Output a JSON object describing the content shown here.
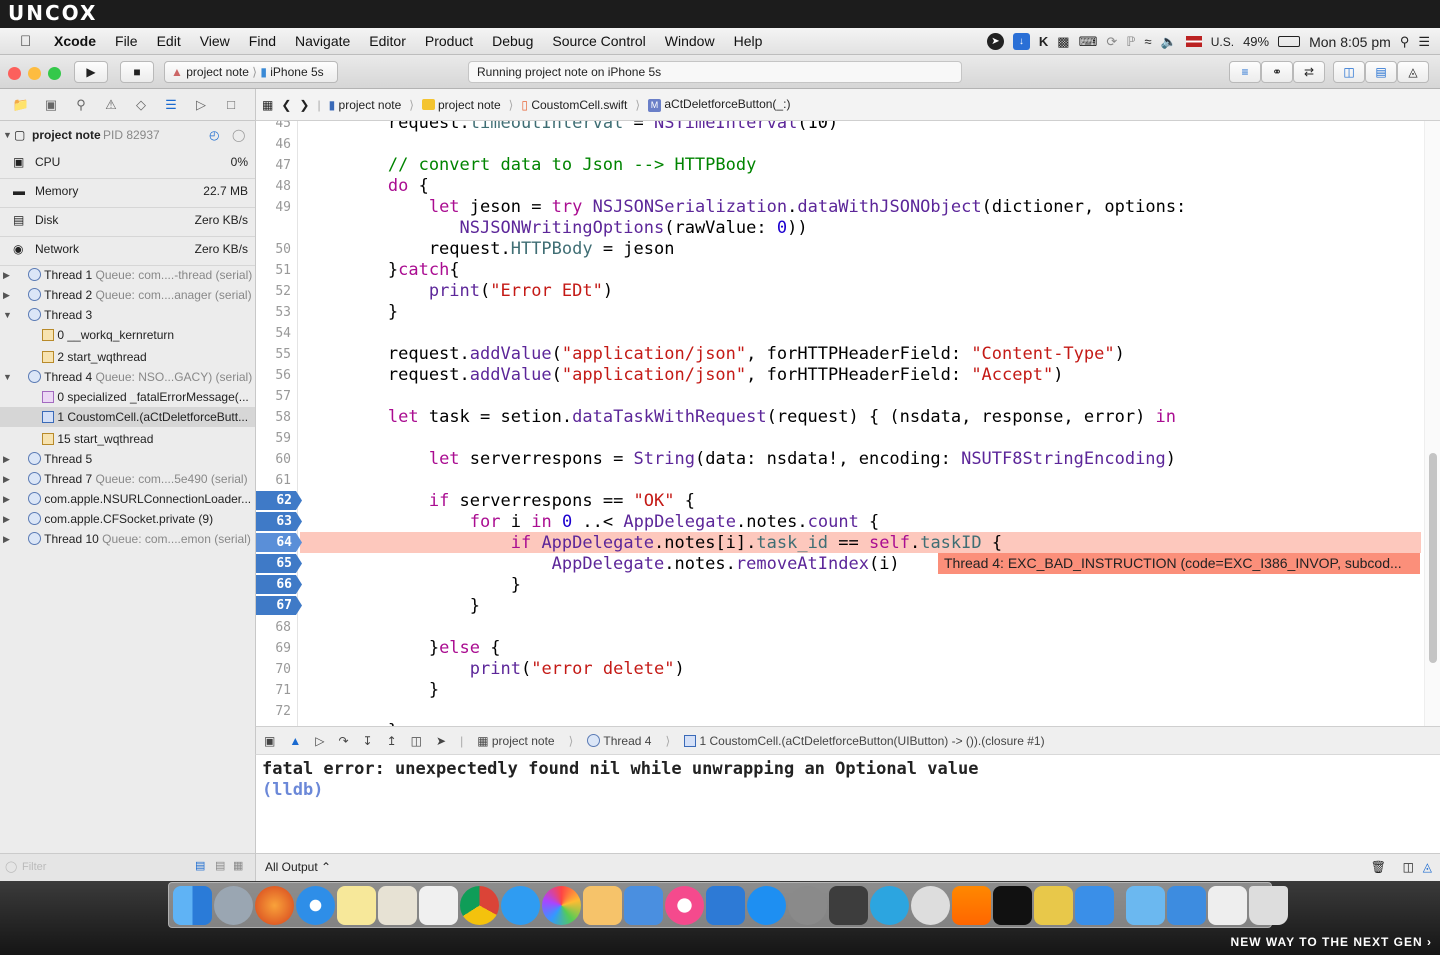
{
  "brand": {
    "logo": "UNCOX",
    "tagline": "NEW WAY TO THE NEXT GEN ›"
  },
  "menubar": {
    "app": "Xcode",
    "items": [
      "File",
      "Edit",
      "View",
      "Find",
      "Navigate",
      "Editor",
      "Product",
      "Debug",
      "Source Control",
      "Window",
      "Help"
    ],
    "input_source": "U.S.",
    "battery": "49%",
    "clock": "Mon 8:05 pm"
  },
  "toolbar": {
    "scheme_target": "project note",
    "scheme_device": "iPhone 5s",
    "activity": "Running project note on iPhone 5s"
  },
  "jumpbar": {
    "items": [
      "project note",
      "project note",
      "CoustomCell.swift",
      "aCtDeletforceButton(_:)"
    ]
  },
  "debug_navigator": {
    "process": "project note",
    "pid": "PID 82937",
    "gauges": [
      {
        "name": "CPU",
        "value": "0%"
      },
      {
        "name": "Memory",
        "value": "22.7 MB"
      },
      {
        "name": "Disk",
        "value": "Zero KB/s"
      },
      {
        "name": "Network",
        "value": "Zero KB/s"
      }
    ],
    "threads": [
      {
        "name": "Thread 1",
        "queue": "Queue: com....-thread (serial)"
      },
      {
        "name": "Thread 2",
        "queue": "Queue: com....anager (serial)"
      },
      {
        "name": "Thread 3",
        "queue": ""
      },
      {
        "frame": "0 __workq_kernreturn"
      },
      {
        "frame": "2 start_wqthread"
      },
      {
        "name": "Thread 4",
        "queue": "Queue: NSO...GACY) (serial)"
      },
      {
        "frame": "0 specialized _fatalErrorMessage(..."
      },
      {
        "frame": "1 CoustomCell.(aCtDeletforceButt..."
      },
      {
        "frame": "15 start_wqthread"
      },
      {
        "name": "Thread 5",
        "queue": ""
      },
      {
        "name": "Thread 7",
        "queue": "Queue: com....5e490 (serial)"
      },
      {
        "name": "com.apple.NSURLConnectionLoader...",
        "queue": ""
      },
      {
        "name": "com.apple.CFSocket.private (9)",
        "queue": ""
      },
      {
        "name": "Thread 10",
        "queue": "Queue: com....emon (serial)"
      }
    ],
    "filter_placeholder": "Filter"
  },
  "editor": {
    "line_numbers": [
      "45",
      "46",
      "47",
      "48",
      "49",
      "",
      "50",
      "51",
      "52",
      "53",
      "54",
      "55",
      "56",
      "57",
      "58",
      "59",
      "60",
      "61",
      "62",
      "63",
      "64",
      "65",
      "66",
      "67",
      "68",
      "69",
      "70",
      "71",
      "72"
    ],
    "error_message": "Thread 4: EXC_BAD_INSTRUCTION (code=EXC_I386_INVOP, subcod..."
  },
  "debug_bar": {
    "items": [
      "project note",
      "Thread 4",
      "1 CoustomCell.(aCtDeletforceButton(UIButton) -> ()).(closure #1)"
    ]
  },
  "console": {
    "lines": [
      "fatal error: unexpectedly found nil while unwrapping an Optional value",
      "(lldb)"
    ],
    "output_filter": "All Output ⌃"
  },
  "colors": {
    "breakpoint": "#3f7ac7",
    "error_line": "#fdc8bd",
    "error_badge": "#fb8f7a",
    "keyword": "#aa0d91",
    "string": "#c41a16",
    "comment": "#008400"
  }
}
